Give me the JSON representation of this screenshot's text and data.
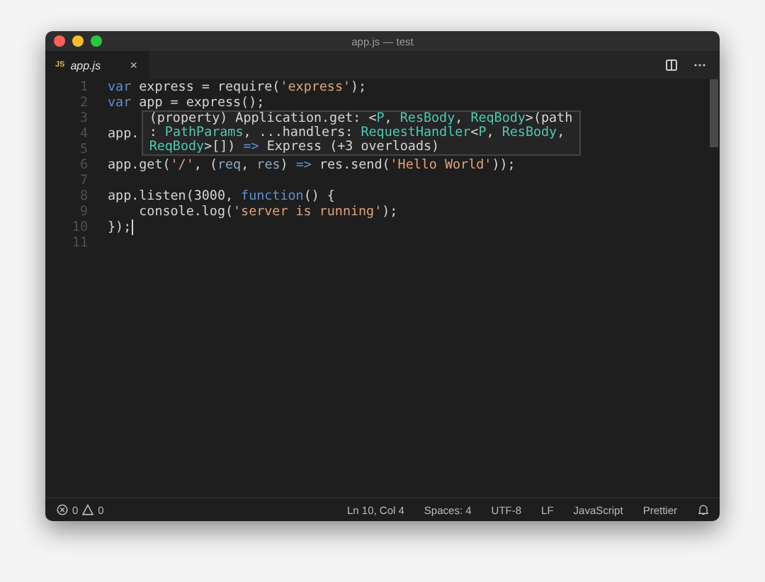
{
  "window": {
    "title": "app.js — test"
  },
  "tabs": [
    {
      "icon_text": "JS",
      "label": "app.js",
      "close": "×",
      "selected": true
    }
  ],
  "editor": {
    "lines": [
      {
        "number": "1",
        "cursor": false,
        "tokens": [
          {
            "text": "var",
            "kind": "keyword"
          },
          {
            "text": " express = require(",
            "kind": "plain"
          },
          {
            "text": "'express'",
            "kind": "string"
          },
          {
            "text": ");",
            "kind": "plain"
          }
        ]
      },
      {
        "number": "2",
        "cursor": false,
        "tokens": [
          {
            "text": "var",
            "kind": "keyword"
          },
          {
            "text": " app = express();",
            "kind": "plain"
          }
        ]
      },
      {
        "number": "3",
        "cursor": false
      },
      {
        "number": "4",
        "cursor": false,
        "tokens": [
          {
            "text": "app.",
            "kind": "plain"
          }
        ]
      },
      {
        "number": "5",
        "cursor": false
      },
      {
        "number": "6",
        "cursor": false,
        "tokens": [
          {
            "text": "app.get(",
            "kind": "plain"
          },
          {
            "text": "'/'",
            "kind": "string"
          },
          {
            "text": ", (",
            "kind": "plain"
          },
          {
            "text": "req",
            "kind": "param"
          },
          {
            "text": ", ",
            "kind": "plain"
          },
          {
            "text": "res",
            "kind": "param"
          },
          {
            "text": ") ",
            "kind": "plain"
          },
          {
            "text": "=>",
            "kind": "keyword"
          },
          {
            "text": " res.send(",
            "kind": "plain"
          },
          {
            "text": "'Hello World'",
            "kind": "string"
          },
          {
            "text": "));",
            "kind": "plain"
          }
        ]
      },
      {
        "number": "7",
        "cursor": false
      },
      {
        "number": "8",
        "cursor": false,
        "tokens": [
          {
            "text": "app.listen(3000, ",
            "kind": "plain"
          },
          {
            "text": "function",
            "kind": "keyword"
          },
          {
            "text": "() {",
            "kind": "plain"
          }
        ]
      },
      {
        "number": "9",
        "cursor": false,
        "tokens": [
          {
            "text": "    console.log(",
            "kind": "plain"
          },
          {
            "text": "'server is running'",
            "kind": "string"
          },
          {
            "text": ");",
            "kind": "plain"
          }
        ]
      },
      {
        "number": "10",
        "cursor": true,
        "tokens": [
          {
            "text": "});",
            "kind": "plain"
          }
        ]
      },
      {
        "number": "11",
        "cursor": false
      }
    ],
    "hover": {
      "lines": [
        [
          {
            "text": "(property) Application.get: <",
            "kind": "plain"
          },
          {
            "text": "P",
            "kind": "type"
          },
          {
            "text": ", ",
            "kind": "plain"
          },
          {
            "text": "ResBody",
            "kind": "type"
          },
          {
            "text": ", ",
            "kind": "plain"
          },
          {
            "text": "ReqBody",
            "kind": "type"
          },
          {
            "text": ">(path",
            "kind": "plain"
          }
        ],
        [
          {
            "text": ": ",
            "kind": "plain"
          },
          {
            "text": "PathParams",
            "kind": "type"
          },
          {
            "text": ", ...handlers: ",
            "kind": "plain"
          },
          {
            "text": "RequestHandler",
            "kind": "type"
          },
          {
            "text": "<",
            "kind": "plain"
          },
          {
            "text": "P",
            "kind": "type"
          },
          {
            "text": ", ",
            "kind": "plain"
          },
          {
            "text": "ResBody",
            "kind": "type"
          },
          {
            "text": ",",
            "kind": "plain"
          }
        ],
        [
          {
            "text": "ReqBody",
            "kind": "type"
          },
          {
            "text": ">[]) ",
            "kind": "plain"
          },
          {
            "text": "=>",
            "kind": "keyword"
          },
          {
            "text": " Express (+3 overloads)",
            "kind": "plain"
          }
        ]
      ]
    }
  },
  "status_bar": {
    "errors": "0",
    "warnings": "0",
    "items": [
      "Ln 10, Col 4",
      "Spaces: 4",
      "UTF-8",
      "LF",
      "JavaScript",
      "Prettier"
    ]
  }
}
